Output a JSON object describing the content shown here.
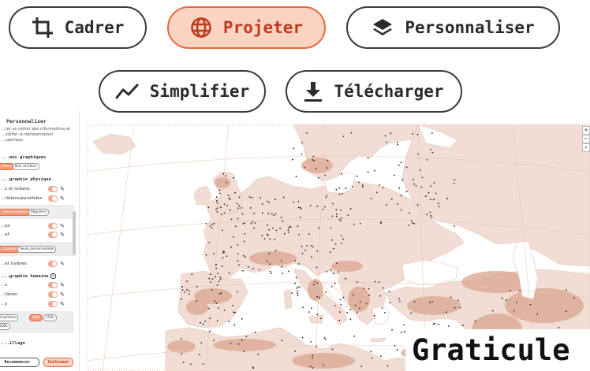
{
  "toolbar": {
    "cadrer": {
      "label": "Cadrer",
      "icon": "crop-icon"
    },
    "projeter": {
      "label": "Projeter",
      "icon": "globe-icon",
      "active": true
    },
    "personnaliser": {
      "label": "Personnaliser",
      "icon": "layers-icon"
    },
    "simplifier": {
      "label": "Simplifier",
      "icon": "line-chart-icon"
    },
    "telecharger": {
      "label": "Télécharger",
      "icon": "download-icon"
    }
  },
  "panel": {
    "title": "Personnaliser",
    "description": "...ter ou retirer des informations et ...odifier la représentation ...raphique.",
    "themes_heading": "...mes graphiques",
    "themes": [
      "...leurs",
      "Noir et blanc"
    ],
    "physique_heading": "...graphie physique",
    "physique_rows": [
      {
        "label": "...s et océans"
      },
      {
        "label": "...ridiens/parallèles"
      }
    ],
    "graticule_options": [
      "...Personnalisées",
      "Réguliers"
    ],
    "physique_rows2": [
      {
        "label": "...es"
      },
      {
        "label": "...ef"
      }
    ],
    "relief_options": [
      "...Couleurs",
      "Seule personnalisée"
    ],
    "rivers_label": "...et rivières",
    "humaine_heading": "...graphie humaine",
    "humaine_rows": [
      {
        "label": "...s"
      },
      {
        "label": "...tières"
      },
      {
        "label": "...s"
      }
    ],
    "pop_options": [
      "Capitales",
      "100k",
      "250k",
      "500k"
    ],
    "section_bottom": "...illage",
    "btn_recommencer": "Recommencer",
    "btn_continuer": "Continuer"
  },
  "map": {
    "land_color": "#f1ddd4",
    "relief_color": "#d9a58f",
    "sea_color": "#ffffff",
    "zoom_in": "+",
    "zoom_out": "−"
  },
  "overlay_label": "Graticule",
  "colors": {
    "accent": "#e36a3e",
    "accent_bg": "#fbd3c2",
    "border": "#3a3a3a"
  }
}
